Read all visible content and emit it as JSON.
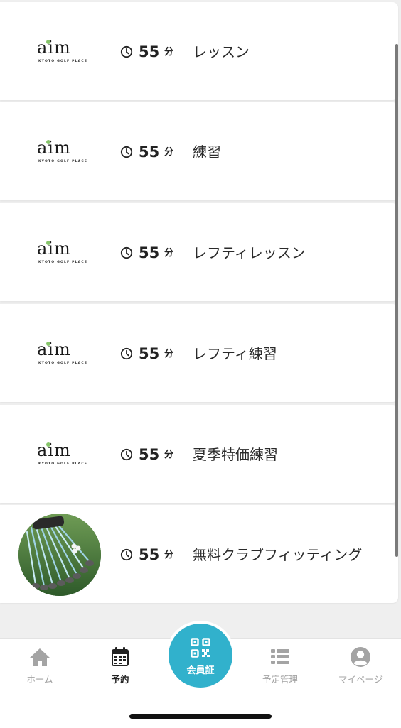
{
  "lessons": [
    {
      "logo": {
        "word": "aim",
        "tagline": "KYOTO GOLF PLACE"
      },
      "duration": "55",
      "unit": "分",
      "name": "レッスン"
    },
    {
      "logo": {
        "word": "aim",
        "tagline": "KYOTO GOLF PLACE"
      },
      "duration": "55",
      "unit": "分",
      "name": "練習"
    },
    {
      "logo": {
        "word": "aim",
        "tagline": "KYOTO GOLF PLACE"
      },
      "duration": "55",
      "unit": "分",
      "name": "レフティレッスン"
    },
    {
      "logo": {
        "word": "aim",
        "tagline": "KYOTO GOLF PLACE"
      },
      "duration": "55",
      "unit": "分",
      "name": "レフティ練習"
    },
    {
      "logo": {
        "word": "aim",
        "tagline": "KYOTO GOLF PLACE"
      },
      "duration": "55",
      "unit": "分",
      "name": "夏季特価練習"
    },
    {
      "image": "golf-clubs-photo",
      "duration": "55",
      "unit": "分",
      "name": "無料クラブフィッティング"
    }
  ],
  "tabs": {
    "home": {
      "label": "ホーム",
      "icon": "home-icon"
    },
    "reserve": {
      "label": "予約",
      "icon": "calendar-icon",
      "active": true
    },
    "member_card": {
      "label": "会員証",
      "icon": "qr-code-icon"
    },
    "schedule": {
      "label": "予定管理",
      "icon": "list-icon"
    },
    "mypage": {
      "label": "マイページ",
      "icon": "user-icon"
    }
  },
  "colors": {
    "accent": "#31b1cc",
    "logo_ball": "#86c46a",
    "inactive_tab": "#a4a4a4"
  }
}
